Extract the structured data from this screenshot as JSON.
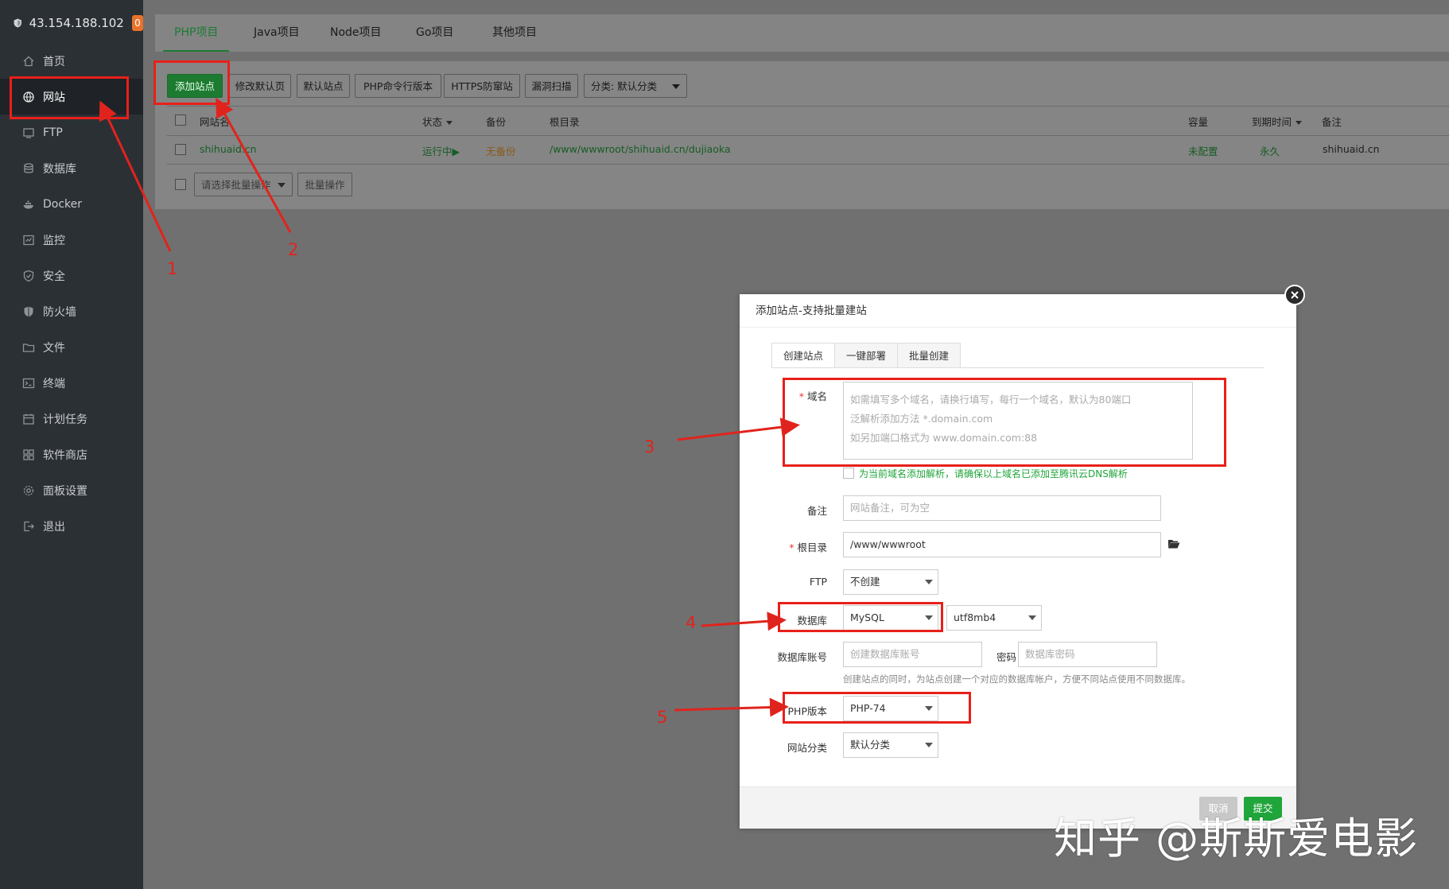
{
  "sidebar": {
    "server_ip": "43.154.188.102",
    "badge": "0",
    "items": [
      {
        "label": "首页",
        "icon": "home-icon"
      },
      {
        "label": "网站",
        "icon": "globe-icon"
      },
      {
        "label": "FTP",
        "icon": "ftp-icon"
      },
      {
        "label": "数据库",
        "icon": "database-icon"
      },
      {
        "label": "Docker",
        "icon": "docker-icon"
      },
      {
        "label": "监控",
        "icon": "monitor-icon"
      },
      {
        "label": "安全",
        "icon": "shield-check-icon"
      },
      {
        "label": "防火墙",
        "icon": "firewall-icon"
      },
      {
        "label": "文件",
        "icon": "folder-icon"
      },
      {
        "label": "终端",
        "icon": "terminal-icon"
      },
      {
        "label": "计划任务",
        "icon": "calendar-icon"
      },
      {
        "label": "软件商店",
        "icon": "apps-icon"
      },
      {
        "label": "面板设置",
        "icon": "gear-icon"
      },
      {
        "label": "退出",
        "icon": "logout-icon"
      }
    ]
  },
  "project_tabs": [
    "PHP项目",
    "Java项目",
    "Node项目",
    "Go项目",
    "其他项目"
  ],
  "toolbar": {
    "add_site": "添加站点",
    "edit_default_page": "修改默认页",
    "default_site": "默认站点",
    "php_cli_version": "PHP命令行版本",
    "https_protection": "HTTPS防窜站",
    "vuln_scan": "漏洞扫描",
    "category_select": "分类: 默认分类"
  },
  "table": {
    "headers": {
      "site_name": "网站名",
      "status": "状态",
      "backup": "备份",
      "root_dir": "根目录",
      "capacity": "容量",
      "expire": "到期时间",
      "remark": "备注"
    },
    "rows": [
      {
        "site_name": "shihuaid.cn",
        "status": "运行中▶",
        "backup": "无备份",
        "root_dir": "/www/wwwroot/shihuaid.cn/dujiaoka",
        "capacity": "未配置",
        "expire": "永久",
        "remark": "shihuaid.cn"
      }
    ],
    "batch_placeholder": "请选择批量操作",
    "batch_button": "批量操作"
  },
  "modal": {
    "title": "添加站点-支持批量建站",
    "tabs": [
      "创建站点",
      "一键部署",
      "批量创建"
    ],
    "domain_label": "域名",
    "domain_placeholder_lines": [
      "如需填写多个域名，请换行填写，每行一个域名，默认为80端口",
      "泛解析添加方法 *.domain.com",
      "如另加端口格式为 www.domain.com:88"
    ],
    "dns_checkbox_text": "为当前域名添加解析，请确保以上域名已添加至腾讯云DNS解析",
    "remark_label": "备注",
    "remark_placeholder": "网站备注，可为空",
    "root_label": "根目录",
    "root_value": "/www/wwwroot",
    "ftp_label": "FTP",
    "ftp_value": "不创建",
    "db_label": "数据库",
    "db_value": "MySQL",
    "db_charset": "utf8mb4",
    "db_account_label": "数据库账号",
    "db_account_placeholder": "创建数据库账号",
    "db_password_label": "密码",
    "db_password_placeholder": "数据库密码",
    "db_hint": "创建站点的同时，为站点创建一个对应的数据库帐户，方便不同站点使用不同数据库。",
    "php_label": "PHP版本",
    "php_value": "PHP-74",
    "category_label": "网站分类",
    "category_value": "默认分类",
    "cancel_button": "取消",
    "submit_button": "提交"
  },
  "annotations": [
    "1",
    "2",
    "3",
    "4",
    "5"
  ],
  "watermark": "知乎 @斯斯爱电影",
  "colors": {
    "accent_green": "#20a53a",
    "annotation_red": "#e8201a",
    "sidebar_bg": "#2b3035"
  }
}
